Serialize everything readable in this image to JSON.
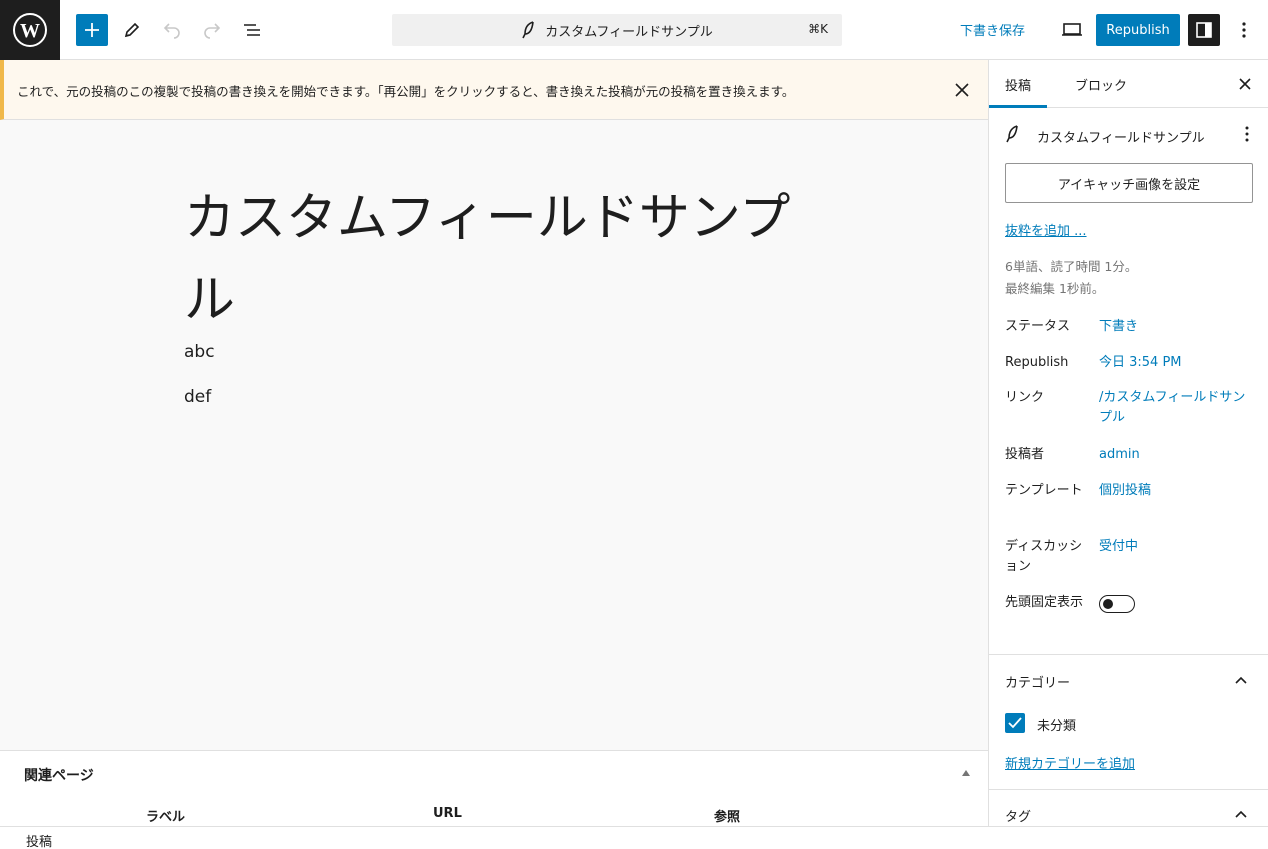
{
  "toolbar": {
    "command_title": "カスタムフィールドサンプル",
    "command_shortcut": "⌘K",
    "save_draft_label": "下書き保存",
    "republish_label": "Republish",
    "accent_color": "#007cba"
  },
  "notice": {
    "text": "これで、元の投稿のこの複製で投稿の書き換えを開始できます。「再公開」をクリックすると、書き換えた投稿が元の投稿を置き換えます。"
  },
  "editor": {
    "title": "カスタムフィールドサンプル",
    "paragraphs": [
      "abc",
      "def"
    ]
  },
  "metabox": {
    "title": "関連ページ",
    "columns": [
      "ラベル",
      "URL",
      "参照"
    ]
  },
  "footer": {
    "breadcrumb": "投稿"
  },
  "sidebar": {
    "tabs": [
      "投稿",
      "ブロック"
    ],
    "post_name": "カスタムフィールドサンプル",
    "featured_image_label": "アイキャッチ画像を設定",
    "excerpt_label": "抜粋を追加 ...",
    "post_info_line1": "6単語、読了時間 1分。",
    "post_info_line2": "最終編集 1秒前。",
    "meta": {
      "status_label": "ステータス",
      "status_value": "下書き",
      "republish_label": "Republish",
      "republish_value": "今日 3:54 PM",
      "link_label": "リンク",
      "link_value": "/カスタムフィールドサンプル",
      "author_label": "投稿者",
      "author_value": "admin",
      "template_label": "テンプレート",
      "template_value": "個別投稿",
      "discussion_label": "ディスカッション",
      "discussion_value": "受付中",
      "sticky_label": "先頭固定表示"
    },
    "categories": {
      "title": "カテゴリー",
      "items": [
        "未分類"
      ],
      "add_label": "新規カテゴリーを追加"
    },
    "tags": {
      "title": "タグ"
    }
  }
}
